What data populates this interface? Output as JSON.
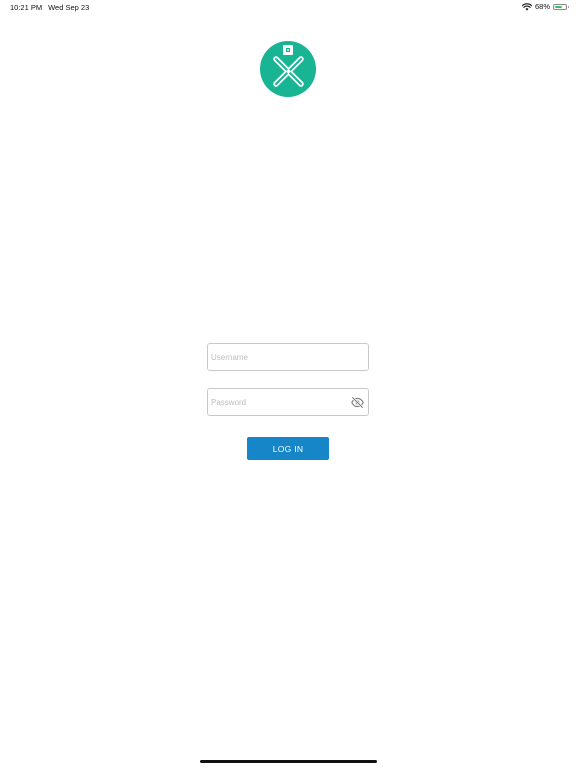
{
  "status_bar": {
    "time": "10:21 PM",
    "date": "Wed Sep 23",
    "battery_percent": "68%",
    "battery_level": 0.68,
    "battery_color": "#33c759",
    "icons": [
      "wifi-icon",
      "battery-icon"
    ]
  },
  "logo": {
    "icon": "x-logo-icon",
    "background_color": "#18b494"
  },
  "login_form": {
    "username_placeholder": "Username",
    "username_value": "",
    "password_placeholder": "Password",
    "password_value": "",
    "password_toggle_icon": "eye-slash-icon",
    "login_label": "LOG IN",
    "login_button_color": "#1786c8"
  }
}
